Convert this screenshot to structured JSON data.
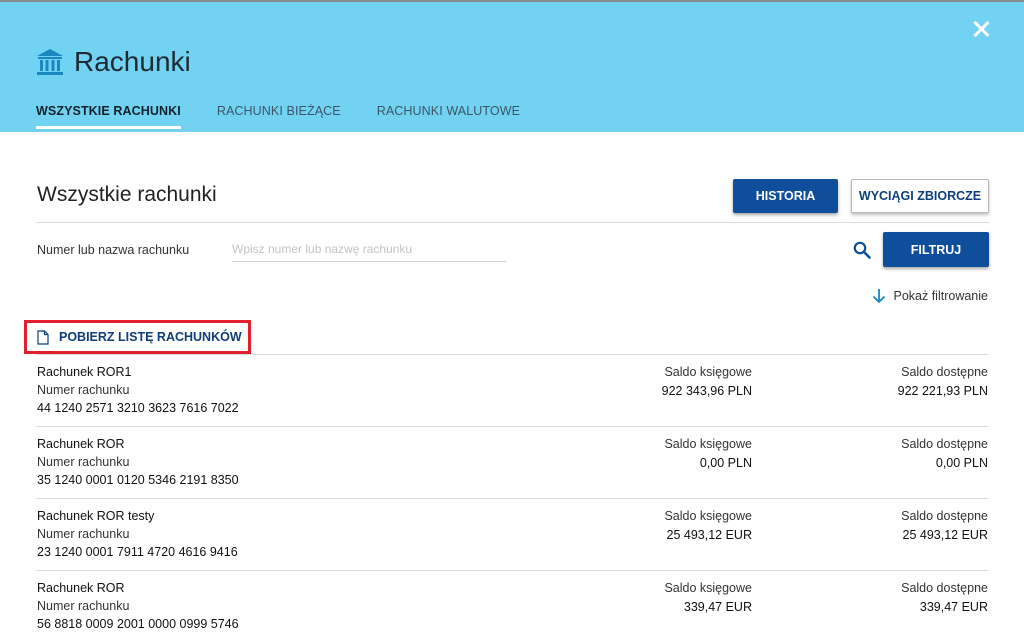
{
  "header": {
    "title": "Rachunki",
    "tabs": [
      {
        "label": "WSZYSTKIE RACHUNKI"
      },
      {
        "label": "RACHUNKI BIEŻĄCE"
      },
      {
        "label": "RACHUNKI WALUTOWE"
      }
    ]
  },
  "main": {
    "title": "Wszystkie rachunki",
    "historia_label": "HISTORIA",
    "wyciagi_label": "WYCIĄGI ZBIORCZE",
    "filter": {
      "label": "Numer lub nazwa rachunku",
      "placeholder": "Wpisz numer lub nazwę rachunku",
      "value": "",
      "button_label": "FILTRUJ"
    },
    "show_filter_label": "Pokaż filtrowanie",
    "download_label": "POBIERZ LISTĘ RACHUNKÓW",
    "accounts": [
      {
        "name": "Rachunek ROR1",
        "number_label": "Numer rachunku",
        "number": "44 1240 2571 3210 3623 7616 7022",
        "book_label": "Saldo księgowe",
        "book_value": "922 343,96  PLN",
        "avail_label": "Saldo dostępne",
        "avail_value": "922 221,93  PLN"
      },
      {
        "name": "Rachunek ROR",
        "number_label": "Numer rachunku",
        "number": "35 1240 0001 0120 5346 2191 8350",
        "book_label": "Saldo księgowe",
        "book_value": "0,00  PLN",
        "avail_label": "Saldo dostępne",
        "avail_value": "0,00  PLN"
      },
      {
        "name": "Rachunek ROR testy",
        "number_label": "Numer rachunku",
        "number": "23 1240 0001 7911 4720 4616 9416",
        "book_label": "Saldo księgowe",
        "book_value": "25 493,12  EUR",
        "avail_label": "Saldo dostępne",
        "avail_value": "25 493,12  EUR"
      },
      {
        "name": "Rachunek ROR",
        "number_label": "Numer rachunku",
        "number": "56 8818 0009 2001 0000 0999 5746",
        "book_label": "Saldo księgowe",
        "book_value": "339,47  EUR",
        "avail_label": "Saldo dostępne",
        "avail_value": "339,47  EUR"
      }
    ]
  },
  "icons": {
    "bank": "bank-icon",
    "close": "close-icon",
    "search": "search-icon",
    "arrow": "arrow-down-icon",
    "document": "document-icon"
  },
  "colors": {
    "header_bg": "#71d2f2",
    "primary": "#0e4e9a",
    "highlight": "#e0202e"
  }
}
